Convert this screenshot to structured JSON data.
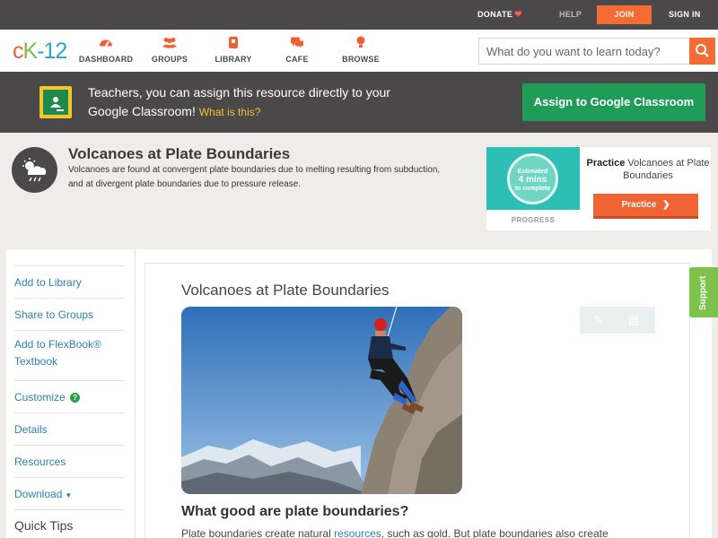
{
  "topbar": {
    "donate": "DONATE",
    "help": "HELP",
    "join": "JOIN",
    "sign_in": "SIGN IN"
  },
  "logo": {
    "c": "c",
    "k": "K",
    "twelve": "-12"
  },
  "nav": {
    "items": [
      {
        "label": "DASHBOARD",
        "icon": "dashboard-icon"
      },
      {
        "label": "GROUPS",
        "icon": "groups-icon"
      },
      {
        "label": "LIBRARY",
        "icon": "library-icon"
      },
      {
        "label": "CAFE",
        "icon": "cafe-icon"
      },
      {
        "label": "BROWSE",
        "icon": "browse-icon"
      }
    ],
    "search_placeholder": "What do you want to learn today?"
  },
  "banner": {
    "text": "Teachers, you can assign this resource directly to your Google Classroom!",
    "what_link": "What is this?",
    "assign_button": "Assign to Google Classroom"
  },
  "concept": {
    "title": "Volcanoes at Plate Boundaries",
    "description": "Volcanoes are found at convergent plate boundaries due to melting resulting from subduction, and at divergent plate boundaries due to pressure release."
  },
  "practice": {
    "estimate_top": "Estimated",
    "estimate_big": "4 mins",
    "estimate_bottom": "to complete",
    "progress_label": "PROGRESS",
    "title_bold": "Practice",
    "title_rest": "Volcanoes at Plate Boundaries",
    "button": "Practice"
  },
  "sidebar": {
    "items": [
      {
        "label": "Add to Library"
      },
      {
        "label": "Share to Groups"
      },
      {
        "label": "Add to FlexBook® Textbook"
      },
      {
        "label": "Customize"
      },
      {
        "label": "Details"
      },
      {
        "label": "Resources"
      },
      {
        "label": "Download"
      }
    ],
    "quick_tips": "Quick Tips"
  },
  "article": {
    "title": "Volcanoes at Plate Boundaries",
    "subhead": "What good are plate boundaries?",
    "para_start": "Plate boundaries create natural ",
    "para_link": "resources",
    "para_end": ", such as gold. But plate boundaries also create"
  },
  "support": "Support",
  "colors": {
    "accent_orange": "#f56b34",
    "brand_green": "#1e9c58",
    "link_blue": "#2f7fb4",
    "support_green": "#7dc24b",
    "dark_bar": "#4a4848"
  }
}
